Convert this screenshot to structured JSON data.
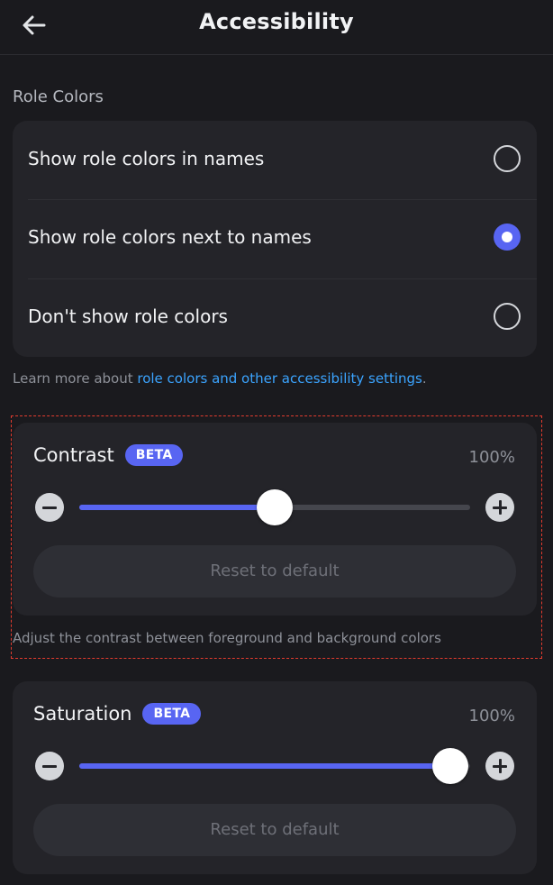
{
  "header": {
    "title": "Accessibility",
    "back_icon": "arrow-left-icon"
  },
  "role_colors": {
    "section_label": "Role Colors",
    "options": [
      {
        "label": "Show role colors in names",
        "selected": false
      },
      {
        "label": "Show role colors next to names",
        "selected": true
      },
      {
        "label": "Don't show role colors",
        "selected": false
      }
    ],
    "learn_more_prefix": "Learn more about ",
    "learn_more_link": "role colors and other accessibility settings",
    "learn_more_suffix": "."
  },
  "contrast": {
    "title": "Contrast",
    "badge": "BETA",
    "value_text": "100%",
    "slider_position": 0.5,
    "reset_label": "Reset to default",
    "description": "Adjust the contrast between foreground and background colors"
  },
  "saturation": {
    "title": "Saturation",
    "badge": "BETA",
    "value_text": "100%",
    "slider_position": 0.95,
    "reset_label": "Reset to default"
  },
  "colors": {
    "accent": "#5865f2",
    "link": "#3ba4ff",
    "highlight_dash": "#e23b2e"
  },
  "icons": {
    "minus": "minus-circle-icon",
    "plus": "plus-circle-icon"
  }
}
